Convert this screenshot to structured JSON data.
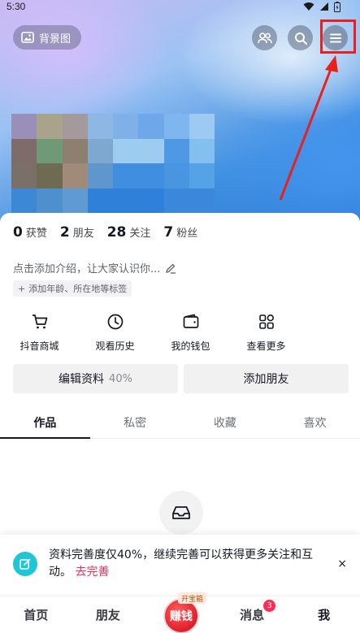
{
  "status_bar": {
    "time": "5:30"
  },
  "header": {
    "background_button_label": "背景图",
    "icons": [
      "friends-icon",
      "search-icon",
      "menu-icon"
    ]
  },
  "stats": [
    {
      "value": "0",
      "label": "获赞"
    },
    {
      "value": "2",
      "label": "朋友"
    },
    {
      "value": "28",
      "label": "关注"
    },
    {
      "value": "7",
      "label": "粉丝"
    }
  ],
  "profile": {
    "intro_placeholder": "点击添加介绍，让大家认识你...",
    "tag_prompt": "添加年龄、所在地等标签"
  },
  "shortcuts": [
    {
      "label": "抖音商城",
      "icon": "cart-icon"
    },
    {
      "label": "观看历史",
      "icon": "clock-icon"
    },
    {
      "label": "我的钱包",
      "icon": "wallet-icon"
    },
    {
      "label": "查看更多",
      "icon": "grid-icon"
    }
  ],
  "actions": {
    "edit_profile_label": "编辑资料",
    "edit_profile_percent": "40%",
    "add_friend_label": "添加朋友"
  },
  "tabs": [
    {
      "label": "作品",
      "active": true
    },
    {
      "label": "私密",
      "active": false
    },
    {
      "label": "收藏",
      "active": false
    },
    {
      "label": "喜欢",
      "active": false
    }
  ],
  "banner": {
    "text": "资料完善度仅40%，继续完善可以获得更多关注和互动。",
    "link": "去完善",
    "close": "×"
  },
  "bottom_nav": {
    "items": [
      "首页",
      "朋友",
      "消息",
      "我"
    ],
    "earn_label": "赚钱",
    "earn_tag": "开宝箱",
    "message_badge": "3"
  },
  "colors": {
    "accent_red": "#fe2c55",
    "highlight_red": "#e8211f",
    "banner_icon": "#20c5d6"
  }
}
